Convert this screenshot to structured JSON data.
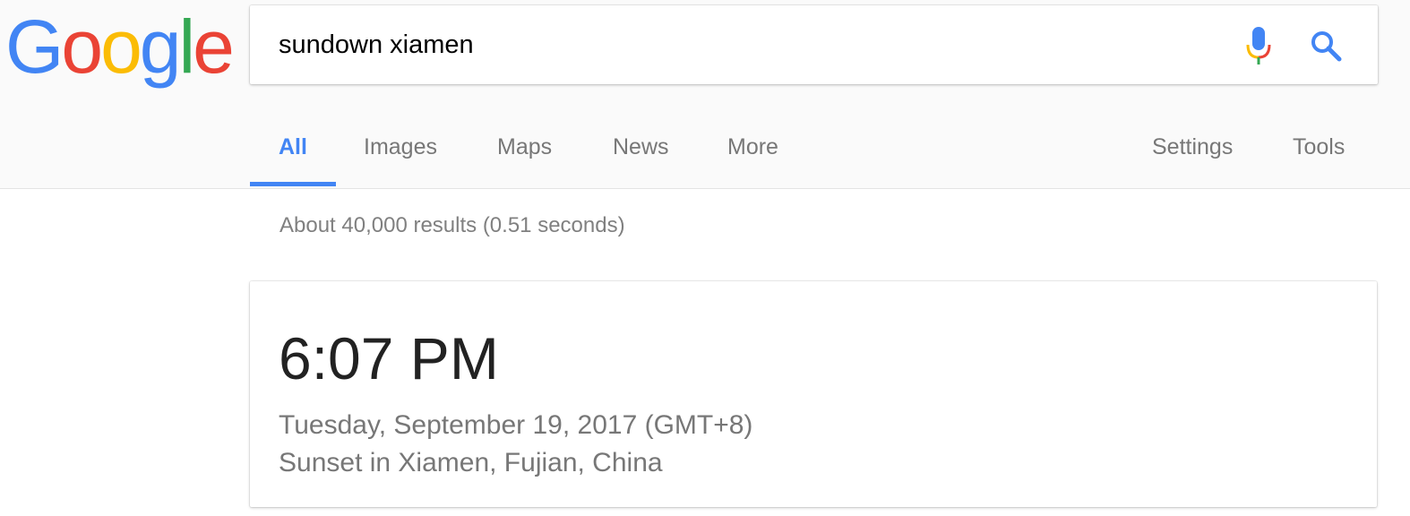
{
  "logo": {
    "letters": [
      "G",
      "o",
      "o",
      "g",
      "l",
      "e"
    ],
    "colors": [
      "#4285f4",
      "#ea4335",
      "#fbbc05",
      "#4285f4",
      "#34a853",
      "#ea4335"
    ]
  },
  "search": {
    "query": "sundown xiamen",
    "mic_icon": "mic-icon",
    "search_icon": "search-icon"
  },
  "tabs": [
    {
      "label": "All",
      "active": true
    },
    {
      "label": "Images",
      "active": false
    },
    {
      "label": "Maps",
      "active": false
    },
    {
      "label": "News",
      "active": false
    },
    {
      "label": "More",
      "active": false
    }
  ],
  "tools": {
    "settings": "Settings",
    "tools": "Tools"
  },
  "results": {
    "stats": "About 40,000 results (0.51 seconds)"
  },
  "answer_card": {
    "time": "6:07 PM",
    "date": "Tuesday, September 19, 2017 (GMT+8)",
    "place": "Sunset in Xiamen, Fujian, China"
  },
  "colors": {
    "accent": "#4285f4",
    "muted_text": "#777777"
  }
}
